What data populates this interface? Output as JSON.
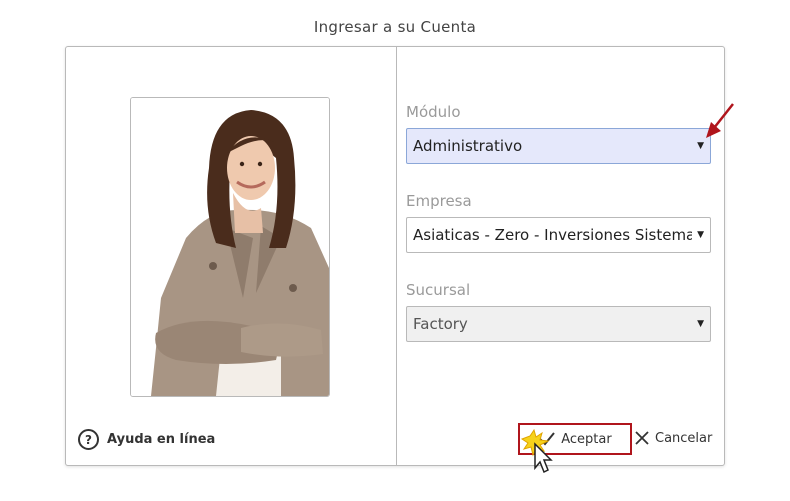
{
  "title": "Ingresar a su Cuenta",
  "help": {
    "label": "Ayuda en línea",
    "icon": "question-circle-icon"
  },
  "fields": {
    "modulo": {
      "label": "Módulo",
      "value": "Administrativo"
    },
    "empresa": {
      "label": "Empresa",
      "value": "Asiaticas - Zero - Inversiones Sistemas"
    },
    "sucursal": {
      "label": "Sucursal",
      "value": "Factory"
    }
  },
  "buttons": {
    "accept": {
      "label": "Aceptar",
      "icon": "checkmark-icon"
    },
    "cancel": {
      "label": "Cancelar",
      "icon": "close-icon"
    }
  },
  "colors": {
    "annotation_red": "#b0151c",
    "focused_select_bg": "#e5e8fb",
    "border": "#b9b9b9"
  }
}
